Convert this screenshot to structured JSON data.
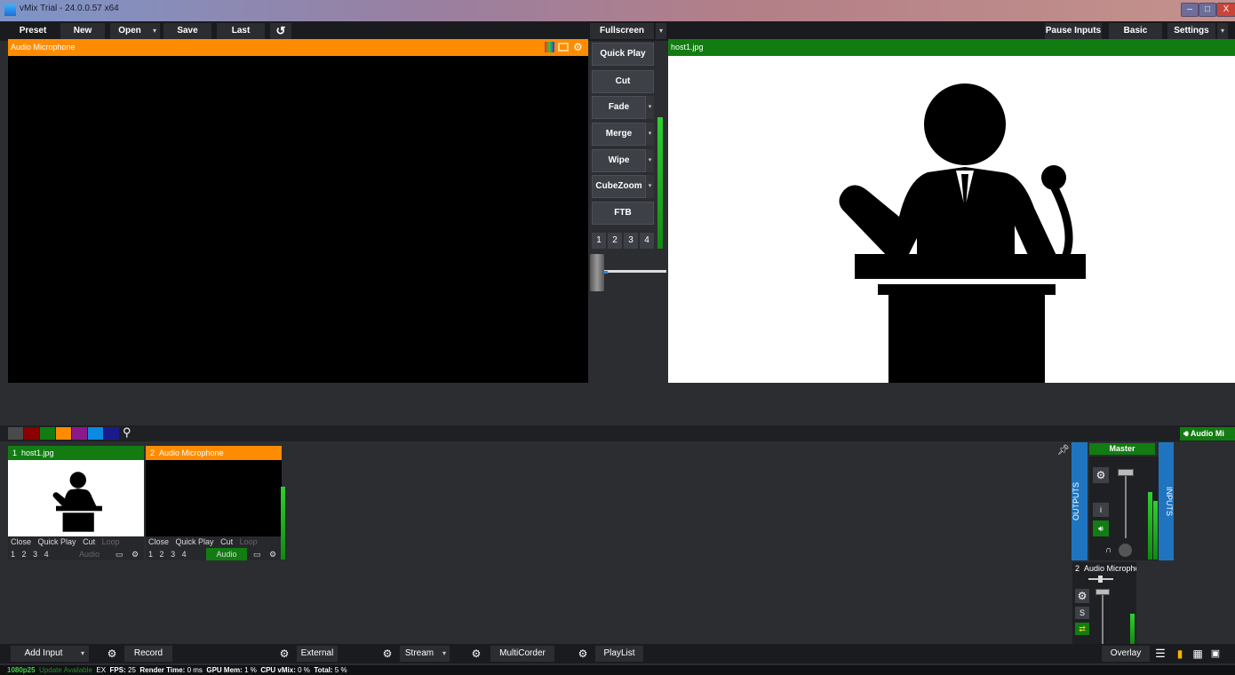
{
  "window": {
    "title": "vMix Trial - 24.0.0.57 x64",
    "min": "–",
    "max": "□",
    "close": "X"
  },
  "toolbar": {
    "preset": "Preset",
    "new": "New",
    "open": "Open",
    "save": "Save",
    "last": "Last",
    "reload_icon": "↺",
    "fullscreen": "Fullscreen",
    "pause_inputs": "Pause Inputs",
    "basic": "Basic",
    "settings": "Settings",
    "dropdown_glyph": "▾"
  },
  "preview": {
    "title": "Audio Microphone",
    "header_color": "#ff8c00"
  },
  "output": {
    "title": "host1.jpg",
    "header_color": "#127c12"
  },
  "transitions": {
    "quick_play": "Quick Play",
    "cut": "Cut",
    "fade": "Fade",
    "merge": "Merge",
    "wipe": "Wipe",
    "cubezoom": "CubeZoom",
    "ftb": "FTB",
    "numbers": [
      "1",
      "2",
      "3",
      "4"
    ]
  },
  "colors": {
    "swatches": [
      "#5a5a5a",
      "#8b0000",
      "#127c12",
      "#ff8c00",
      "#8a1a8a",
      "#0a8ae0",
      "#1a1a8a"
    ]
  },
  "search_icon": "⚲",
  "inputs": [
    {
      "number": "1",
      "name": "host1.jpg",
      "color": "#127c12",
      "close": "Close",
      "quick_play": "Quick Play",
      "cut": "Cut",
      "loop": "Loop",
      "audio": "Audio",
      "audio_active": false,
      "nums": [
        "1",
        "2",
        "3",
        "4"
      ]
    },
    {
      "number": "2",
      "name": "Audio Microphone",
      "color": "#ff8c00",
      "close": "Close",
      "quick_play": "Quick Play",
      "cut": "Cut",
      "loop": "Loop",
      "audio": "Audio",
      "audio_active": true,
      "nums": [
        "1",
        "2",
        "3",
        "4"
      ]
    }
  ],
  "audio_mixer": {
    "header": "Audio Mi",
    "outputs": "OUTPUTS",
    "inputs": "INPUTS",
    "master": "Master",
    "info": "i",
    "solo": "S",
    "channel_num": "2",
    "channel_name": "Audio Microphc"
  },
  "bottom": {
    "add_input": "Add Input",
    "record": "Record",
    "external": "External",
    "stream": "Stream",
    "multicorder": "MultiCorder",
    "playlist": "PlayList",
    "overlay": "Overlay"
  },
  "status": {
    "format": "1080p25",
    "update": "Update Available",
    "ex": "EX",
    "fps_label": "FPS:",
    "fps": "25",
    "render_label": "Render Time:",
    "render": "0 ms",
    "gpu_label": "GPU Mem:",
    "gpu": "1 %",
    "cpu_label": "CPU vMix:",
    "cpu": "0 %",
    "total_label": "Total:",
    "total": "5 %"
  }
}
